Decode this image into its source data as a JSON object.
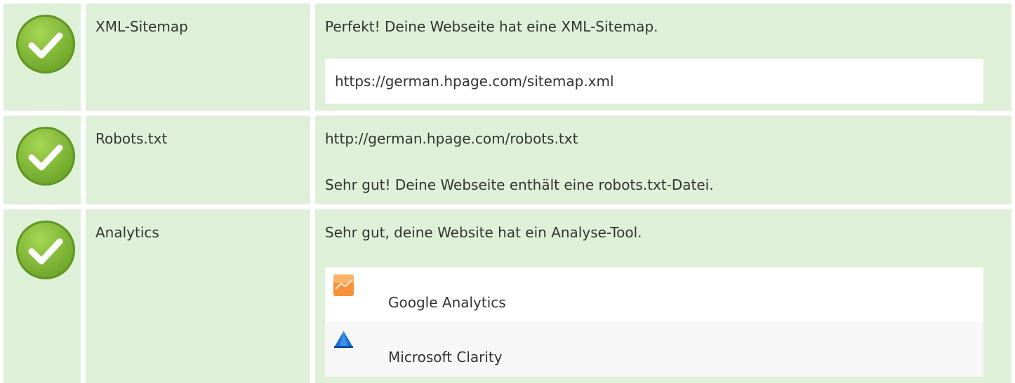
{
  "rows": [
    {
      "status_icon": "check-circle-icon",
      "name": "XML-Sitemap",
      "message": "Perfekt! Deine Webseite hat eine XML-Sitemap.",
      "url": "https://german.hpage.com/sitemap.xml"
    },
    {
      "status_icon": "check-circle-icon",
      "name": "Robots.txt",
      "url": "http://german.hpage.com/robots.txt",
      "message": "Sehr gut! Deine Webseite enthält eine robots.txt-Datei."
    },
    {
      "status_icon": "check-circle-icon",
      "name": "Analytics",
      "message": "Sehr gut, deine Website hat ein Analyse-Tool.",
      "tools": [
        {
          "icon": "google-analytics-icon",
          "label": "Google Analytics"
        },
        {
          "icon": "microsoft-clarity-icon",
          "label": "Microsoft Clarity"
        }
      ]
    }
  ],
  "colors": {
    "row_background": "#dff0d8",
    "check_green": "#8cc63f",
    "text": "#333333",
    "google_analytics_orange": "#f7923a",
    "clarity_blue": "#1a6fd0"
  }
}
